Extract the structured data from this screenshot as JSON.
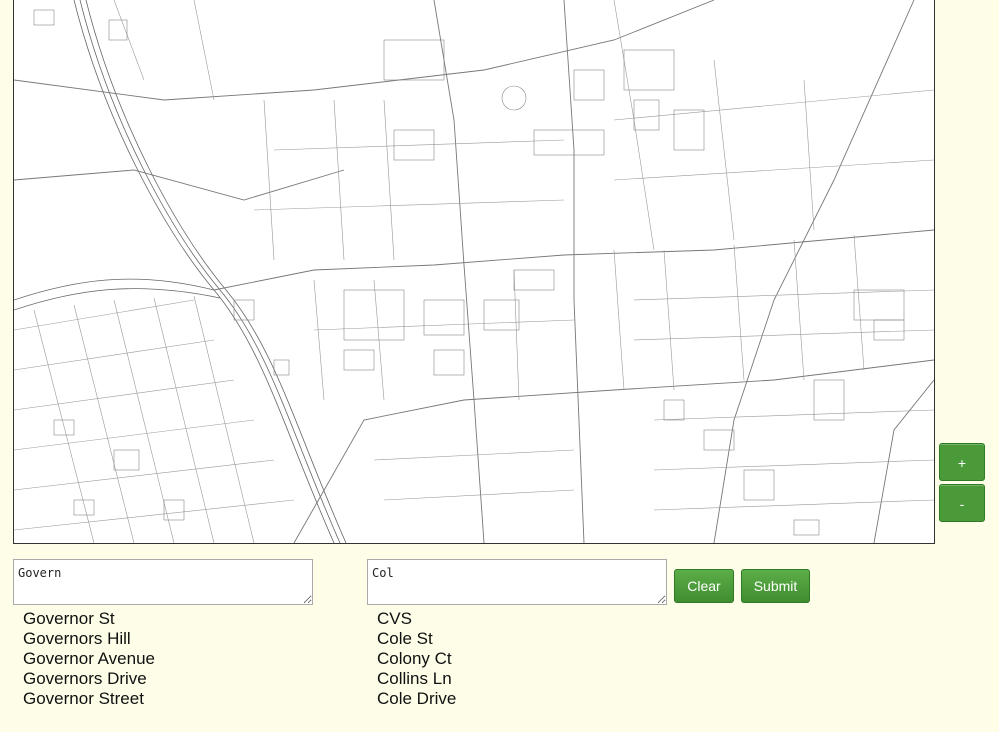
{
  "map": {
    "zoom_in_label": "+",
    "zoom_out_label": "-"
  },
  "search": {
    "from_value": "Govern",
    "to_value": "Col",
    "from_suggestions": [
      "Governor St",
      "Governors Hill",
      "Governor Avenue",
      "Governors Drive",
      "Governor Street"
    ],
    "to_suggestions": [
      "CVS",
      "Cole St",
      "Colony Ct",
      "Collins Ln",
      "Cole Drive"
    ]
  },
  "buttons": {
    "clear_label": "Clear",
    "submit_label": "Submit"
  },
  "colors": {
    "page_background": "#fdfde8",
    "button_green": "#4a9a3a",
    "map_line": "#555555"
  }
}
